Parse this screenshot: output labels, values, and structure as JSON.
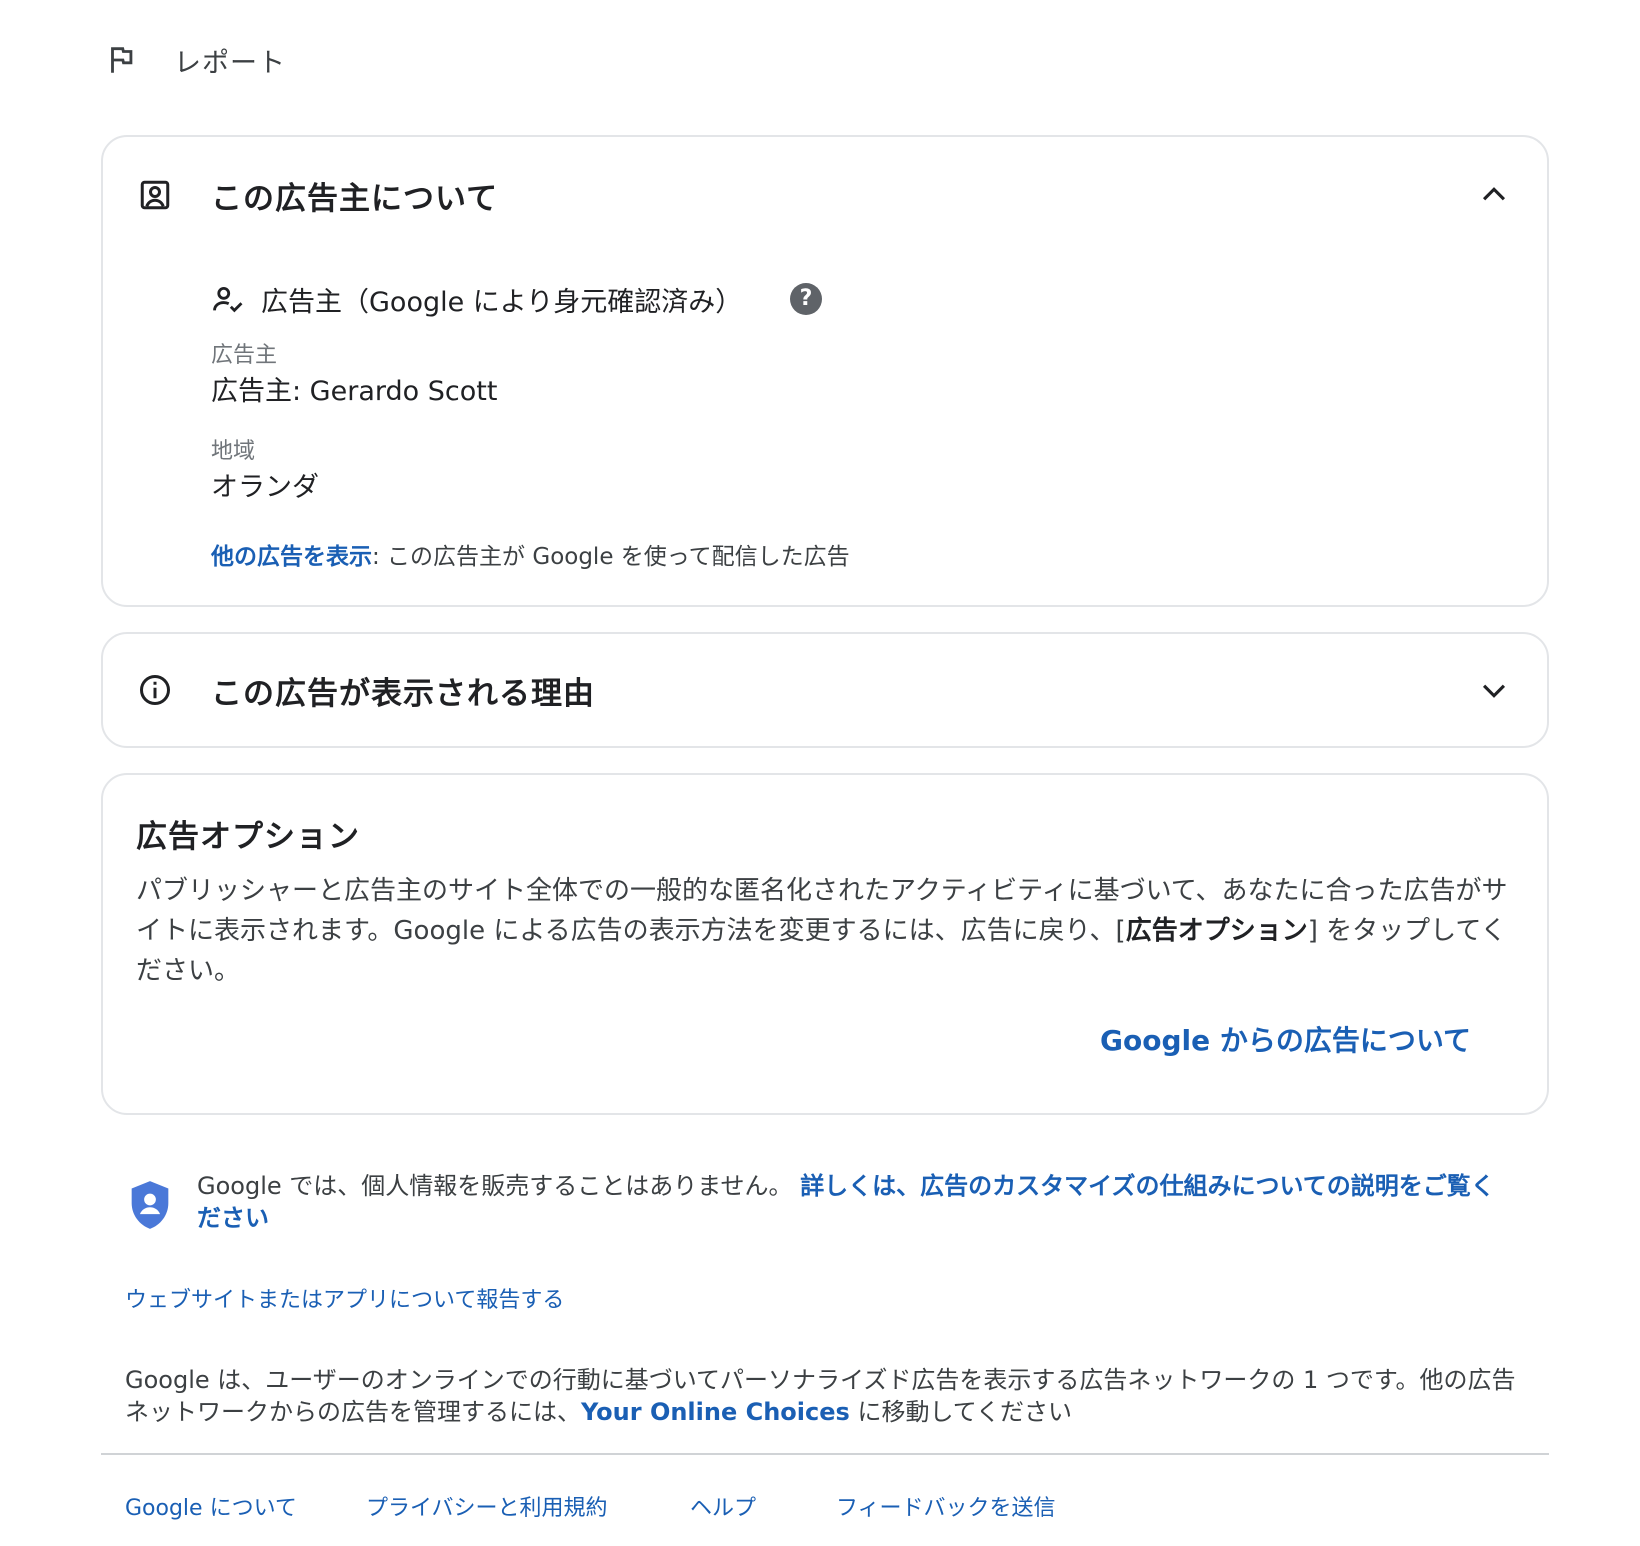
{
  "report": {
    "label": "レポート",
    "icon": "flag-icon"
  },
  "advertiser_card": {
    "title": "この広告主について",
    "icon": "account-box-icon",
    "verified_label": "広告主（Google により身元確認済み）",
    "help_symbol": "?",
    "advertiser_field_label": "広告主",
    "advertiser_value": "広告主: Gerardo Scott",
    "region_field_label": "地域",
    "region_value": "オランダ",
    "more_ads_link": "他の広告を表示",
    "more_ads_text": ": この広告主が Google を使って配信した広告"
  },
  "why_card": {
    "title": "この広告が表示される理由",
    "icon": "info-icon"
  },
  "options_card": {
    "title": "広告オプション",
    "body_text": "パブリッシャーと広告主のサイト全体での一般的な匿名化されたアクティビティに基づいて、あなたに合った広告がサイトに表示されます。Google による広告の表示方法を変更するには、広告に戻り、[",
    "body_bold": "広告オプション",
    "body_end": "] をタップしてください。",
    "link": "Google からの広告について"
  },
  "privacy": {
    "text": "Google では、個人情報を販売することはありません。",
    "link": "詳しくは、広告のカスタマイズの仕組みについての説明をご覧ください",
    "icon": "shield-person-icon"
  },
  "report_site_link": "ウェブサイトまたはアプリについて報告する",
  "network": {
    "text_before": "Google は、ユーザーのオンラインでの行動に基づいてパーソナライズド広告を表示する広告ネットワークの 1 つです。他の広告ネットワークからの広告を管理するには、",
    "link": "Your Online Choices",
    "text_after": " に移動してください"
  },
  "footer": {
    "links": [
      "Google について",
      "プライバシーと利用規約",
      "ヘルプ",
      "フィードバックを送信"
    ]
  },
  "colors": {
    "link": "#1a5fb4",
    "text": "#202124",
    "secondary": "#70757a",
    "shield": "#4a78d8"
  }
}
